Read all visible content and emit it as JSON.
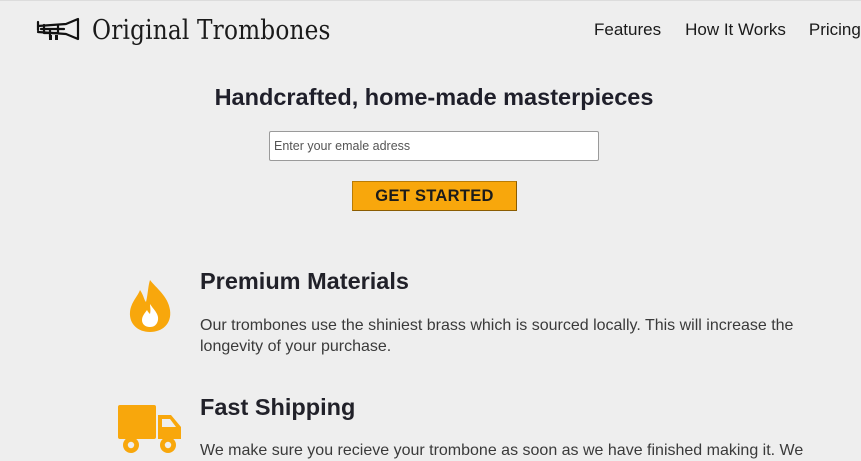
{
  "brand": {
    "name": "Original Trombones",
    "logo_icon": "trombone-icon"
  },
  "nav": {
    "items": [
      {
        "label": "Features"
      },
      {
        "label": "How It Works"
      },
      {
        "label": "Pricing"
      }
    ]
  },
  "hero": {
    "title": "Handcrafted, home-made masterpieces",
    "email_placeholder": "Enter your emale adress",
    "email_value": "",
    "cta_label": "GET STARTED"
  },
  "features": [
    {
      "icon": "fire-icon",
      "title": "Premium Materials",
      "text": "Our trombones use the shiniest brass which is sourced locally. This will increase the longevity of your purchase."
    },
    {
      "icon": "truck-icon",
      "title": "Fast Shipping",
      "text": "We make sure you recieve your trombone as soon as we have finished making it. We"
    }
  ],
  "colors": {
    "background": "#eeeeee",
    "accent": "#f8a70c",
    "icon": "#f8a70c"
  }
}
